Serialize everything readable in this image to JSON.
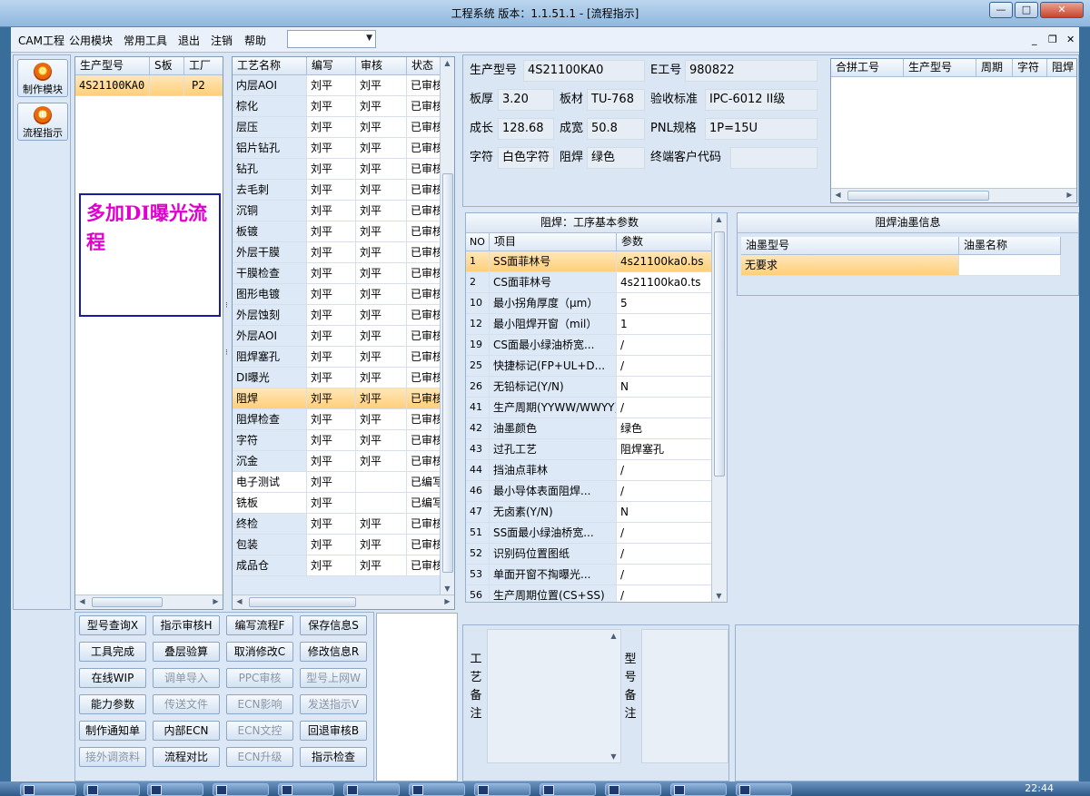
{
  "window": {
    "title": "工程系统   版本：1.1.51.1 - [流程指示]",
    "min": "—",
    "max": "□",
    "close": "✕"
  },
  "menu": {
    "items": [
      "CAM工程",
      "公用模块",
      "常用工具",
      "退出",
      "注销",
      "帮助"
    ],
    "combo_value": "",
    "mdi_min": "_",
    "mdi_restore": "❐",
    "mdi_close": "✕"
  },
  "nav": [
    {
      "label": "制作模块",
      "icon": "gear-icon"
    },
    {
      "label": "流程指示",
      "icon": "flow-icon"
    }
  ],
  "model_grid": {
    "headers": [
      "生产型号",
      "S板",
      "工厂"
    ],
    "rows": [
      [
        "4S21100KA0",
        "",
        "P2"
      ]
    ]
  },
  "note_text": "多加DI曝光流程",
  "process_grid": {
    "headers": [
      "工艺名称",
      "编写",
      "审核",
      "状态"
    ],
    "selected_index": 16,
    "rows": [
      [
        "内层AOI",
        "刘平",
        "刘平",
        "已审核"
      ],
      [
        "棕化",
        "刘平",
        "刘平",
        "已审核"
      ],
      [
        "层压",
        "刘平",
        "刘平",
        "已审核"
      ],
      [
        "铝片钻孔",
        "刘平",
        "刘平",
        "已审核"
      ],
      [
        "钻孔",
        "刘平",
        "刘平",
        "已审核"
      ],
      [
        "去毛刺",
        "刘平",
        "刘平",
        "已审核"
      ],
      [
        "沉铜",
        "刘平",
        "刘平",
        "已审核"
      ],
      [
        "板镀",
        "刘平",
        "刘平",
        "已审核"
      ],
      [
        "外层干膜",
        "刘平",
        "刘平",
        "已审核"
      ],
      [
        "干膜检查",
        "刘平",
        "刘平",
        "已审核"
      ],
      [
        "图形电镀",
        "刘平",
        "刘平",
        "已审核"
      ],
      [
        "外层蚀刻",
        "刘平",
        "刘平",
        "已审核"
      ],
      [
        "外层AOI",
        "刘平",
        "刘平",
        "已审核"
      ],
      [
        "阻焊塞孔",
        "刘平",
        "刘平",
        "已审核"
      ],
      [
        "DI曝光",
        "刘平",
        "刘平",
        "已审核"
      ],
      [
        "阻焊",
        "刘平",
        "刘平",
        "已审核"
      ],
      [
        "阻焊检查",
        "刘平",
        "刘平",
        "已审核"
      ],
      [
        "字符",
        "刘平",
        "刘平",
        "已审核"
      ],
      [
        "沉金",
        "刘平",
        "刘平",
        "已审核"
      ],
      [
        "电子测试",
        "刘平",
        "",
        "已编写"
      ],
      [
        "铣板",
        "刘平",
        "",
        "已编写"
      ],
      [
        "终检",
        "刘平",
        "刘平",
        "已审核"
      ],
      [
        "包装",
        "刘平",
        "刘平",
        "已审核"
      ],
      [
        "成品仓",
        "刘平",
        "刘平",
        "已审核"
      ]
    ]
  },
  "actions": [
    [
      {
        "label": "型号查询X",
        "enabled": true
      },
      {
        "label": "指示审核H",
        "enabled": true
      },
      {
        "label": "编写流程F",
        "enabled": true
      },
      {
        "label": "保存信息S",
        "enabled": true
      }
    ],
    [
      {
        "label": "工具完成",
        "enabled": true
      },
      {
        "label": "叠层验算",
        "enabled": true
      },
      {
        "label": "取消修改C",
        "enabled": true
      },
      {
        "label": "修改信息R",
        "enabled": true
      }
    ],
    [
      {
        "label": "在线WIP",
        "enabled": true
      },
      {
        "label": "调单导入",
        "enabled": false
      },
      {
        "label": "PPC审核",
        "enabled": false
      },
      {
        "label": "型号上网W",
        "enabled": false
      }
    ],
    [
      {
        "label": "能力参数",
        "enabled": true
      },
      {
        "label": "传送文件",
        "enabled": false
      },
      {
        "label": "ECN影响",
        "enabled": false
      },
      {
        "label": "发送指示V",
        "enabled": false
      }
    ],
    [
      {
        "label": "制作通知单",
        "enabled": true
      },
      {
        "label": "内部ECN",
        "enabled": true
      },
      {
        "label": "ECN文控",
        "enabled": false
      },
      {
        "label": "回退审核B",
        "enabled": true
      }
    ],
    [
      {
        "label": "接外调资料",
        "enabled": false
      },
      {
        "label": "流程对比",
        "enabled": true
      },
      {
        "label": "ECN升级",
        "enabled": false
      },
      {
        "label": "指示检查",
        "enabled": true
      }
    ]
  ],
  "info": {
    "model_label": "生产型号",
    "model_value": "4S21100KA0",
    "e_label": "E工号",
    "e_value": "980822",
    "thick_label": "板厚",
    "thick_value": "3.20",
    "mat_label": "板材",
    "mat_value": "TU-768",
    "std_label": "验收标准",
    "std_value": "IPC-6012 II级",
    "len_label": "成长",
    "len_value": "128.68",
    "wid_label": "成宽",
    "wid_value": "50.8",
    "pnl_label": "PNL规格",
    "pnl_value": "1P=15U",
    "char_label": "字符",
    "char_value": "白色字符",
    "mask_label": "阻焊",
    "mask_value": "绿色",
    "cust_label": "终端客户代码",
    "cust_value": ""
  },
  "merge_grid": {
    "headers": [
      "合拼工号",
      "生产型号",
      "周期",
      "字符",
      "阻焊"
    ]
  },
  "param_panel": {
    "title": "阻焊：工序基本参数",
    "headers": [
      "NO",
      "项目",
      "参数"
    ],
    "selected_index": 0,
    "rows": [
      [
        "1",
        "SS面菲林号",
        "4s21100ka0.bs"
      ],
      [
        "2",
        "CS面菲林号",
        "4s21100ka0.ts"
      ],
      [
        "10",
        "最小拐角厚度（μm）",
        "5"
      ],
      [
        "12",
        "最小阻焊开窗（mil）",
        "1"
      ],
      [
        "19",
        "CS面最小绿油桥宽...",
        "/"
      ],
      [
        "25",
        "快捷标记(FP+UL+D...",
        "/"
      ],
      [
        "26",
        "无铅标记(Y/N)",
        "N"
      ],
      [
        "41",
        "生产周期(YYWW/WWYY)",
        "/"
      ],
      [
        "42",
        "油墨颜色",
        "绿色"
      ],
      [
        "43",
        "过孔工艺",
        "阻焊塞孔"
      ],
      [
        "44",
        "挡油点菲林",
        "/"
      ],
      [
        "46",
        "最小导体表面阻焊...",
        "/"
      ],
      [
        "47",
        "无卤素(Y/N)",
        "N"
      ],
      [
        "51",
        "SS面最小绿油桥宽...",
        "/"
      ],
      [
        "52",
        "识别码位置图纸",
        "/"
      ],
      [
        "53",
        "单面开窗不掏曝光...",
        "/"
      ],
      [
        "56",
        "生产周期位置(CS+SS)",
        "/"
      ]
    ]
  },
  "ink_panel": {
    "title": "阻焊油墨信息",
    "headers": [
      "油墨型号",
      "油墨名称"
    ],
    "rows": [
      [
        "无要求",
        ""
      ]
    ]
  },
  "remarks": {
    "process_label": "工艺备注",
    "model_label": "型号备注"
  },
  "taskbar": {
    "clock": "22:44"
  }
}
